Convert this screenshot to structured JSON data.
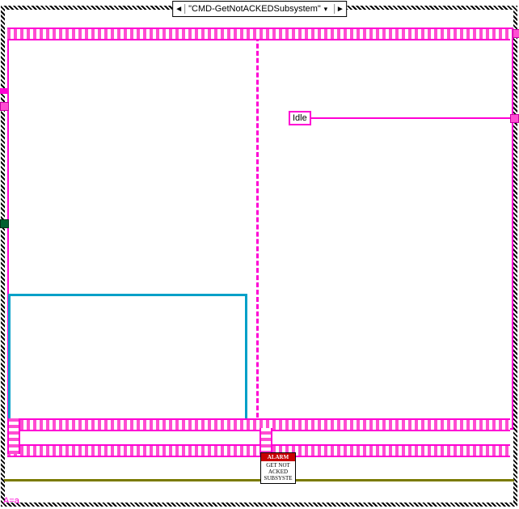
{
  "case_selector": {
    "prev_glyph": "◄",
    "label": "\"CMD-GetNotACKEDSubsystem\"",
    "dropdown_glyph": "▾",
    "next_glyph": "►"
  },
  "idle_tag": {
    "text": "Idle"
  },
  "alarm_subvi": {
    "header": "ALARM",
    "line1": "GET NOT",
    "line2": "ACKED",
    "line3": "SUBSYSTE"
  },
  "bottom_label": {
    "text": "A=a"
  },
  "terminals": {
    "left1": "cluster-terminal",
    "left2": "cluster-terminal",
    "left3": "green-terminal",
    "right_top": "pink-terminal",
    "right_idle": "pink-terminal"
  }
}
